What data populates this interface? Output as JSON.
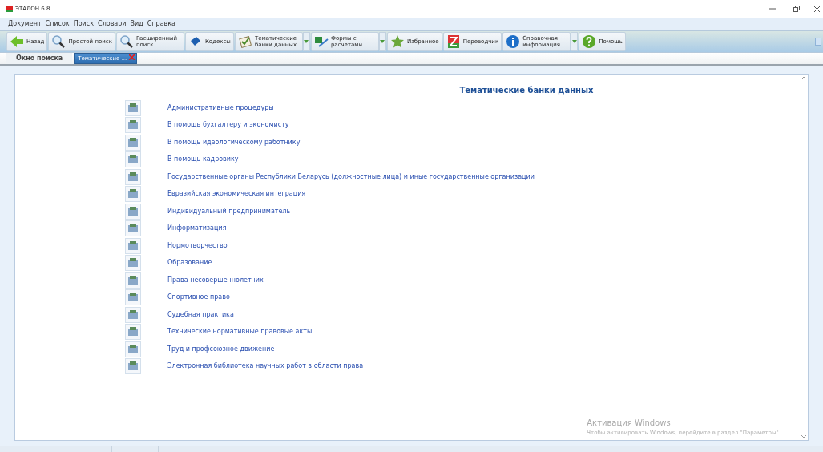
{
  "window": {
    "title": "ЭТАЛОН 6.8"
  },
  "menu": [
    "Документ",
    "Список",
    "Поиск",
    "Словари",
    "Вид",
    "Справка"
  ],
  "toolbar": [
    {
      "kind": "back",
      "label": "Назад",
      "has_menu": false
    },
    {
      "kind": "search",
      "label": "Простой поиск",
      "has_menu": false
    },
    {
      "kind": "search",
      "label": "Расширенный поиск",
      "has_menu": false
    },
    {
      "kind": "book",
      "label": "Кодексы",
      "has_menu": false
    },
    {
      "kind": "check",
      "label": "Тематические банки данных",
      "has_menu": true
    },
    {
      "kind": "forms",
      "label": "Формы с расчетами",
      "has_menu": true
    },
    {
      "kind": "star",
      "label": "Избранное",
      "has_menu": false
    },
    {
      "kind": "translate",
      "label": "Переводчик",
      "has_menu": false
    },
    {
      "kind": "info",
      "label": "Справочная информация",
      "has_menu": true
    },
    {
      "kind": "help",
      "label": "Помощь",
      "has_menu": false
    }
  ],
  "tabs": [
    {
      "label": "Окно поиска",
      "selected": false,
      "closable": false
    },
    {
      "label": "Тематические ...",
      "selected": true,
      "closable": true
    }
  ],
  "content": {
    "title": "Тематические банки данных",
    "items": [
      "Административные процедуры",
      "В помощь бухгалтеру и экономисту",
      "В помощь идеологическому работнику",
      "В помощь кадровику",
      "Государственные органы Республики Беларусь (должностные лица) и иные государственные организации",
      "Евразийская экономическая интеграция",
      "Индивидуальный предприниматель",
      "Информатизация",
      "Нормотворчество",
      "Образование",
      "Права несовершеннолетних",
      "Спортивное право",
      "Судебная практика",
      "Технические нормативные правовые акты",
      "Труд и профсоюзное движение",
      "Электронная библиотека научных работ в области права"
    ]
  },
  "activation": {
    "title": "Активация Windows",
    "text": "Чтобы активировать Windows, перейдите в раздел \"Параметры\"."
  }
}
